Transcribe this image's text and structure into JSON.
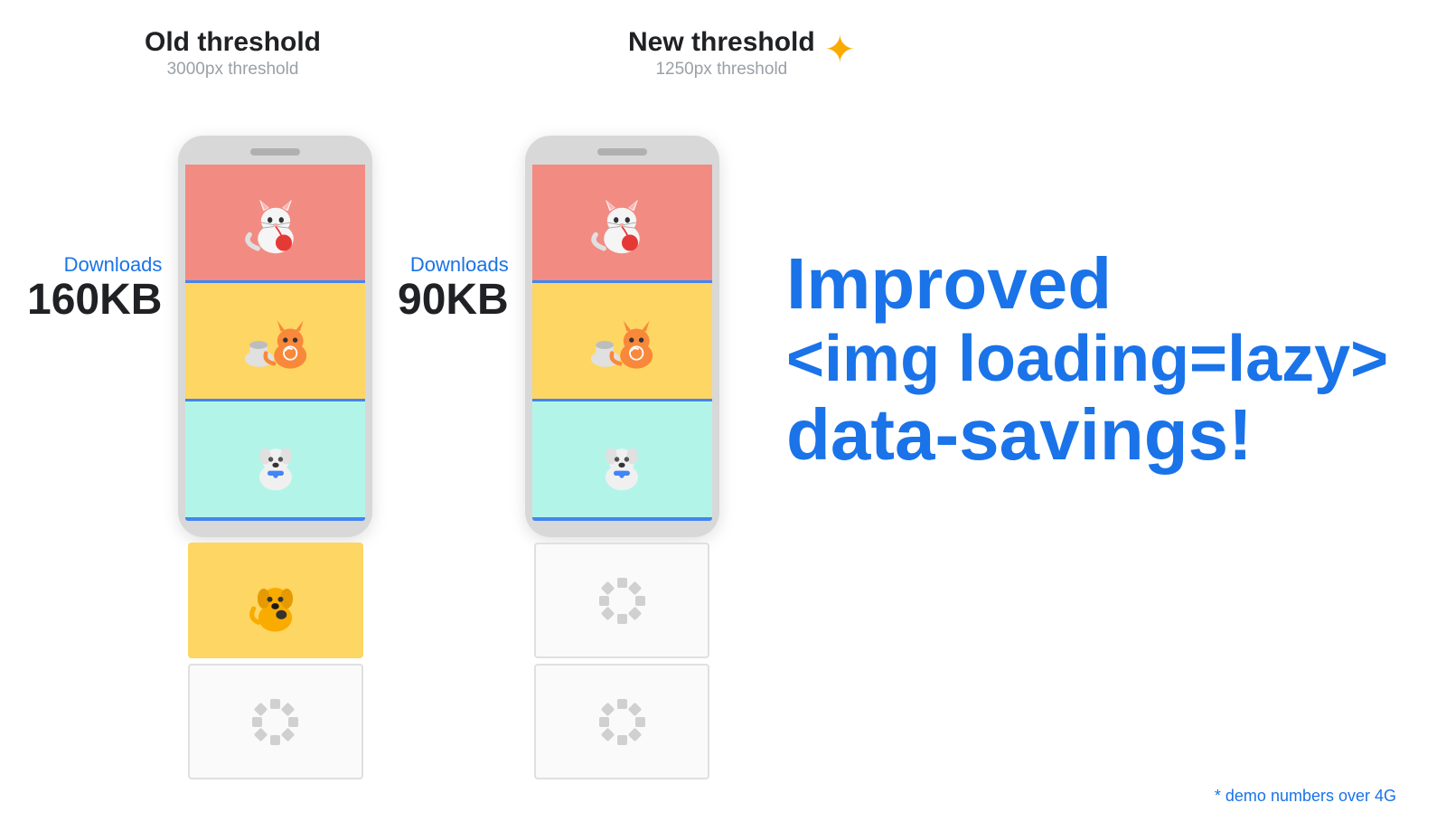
{
  "left": {
    "threshold_title": "Old threshold",
    "threshold_subtitle": "3000px threshold",
    "downloads_label": "Downloads",
    "downloads_size": "160KB"
  },
  "right": {
    "threshold_title": "New threshold",
    "threshold_subtitle": "1250px threshold",
    "downloads_label": "Downloads",
    "downloads_size": "90KB"
  },
  "message": {
    "line1": "Improved",
    "line2": "<img loading=lazy>",
    "line3": "data-savings!"
  },
  "footer": {
    "note": "* demo numbers over 4G"
  }
}
